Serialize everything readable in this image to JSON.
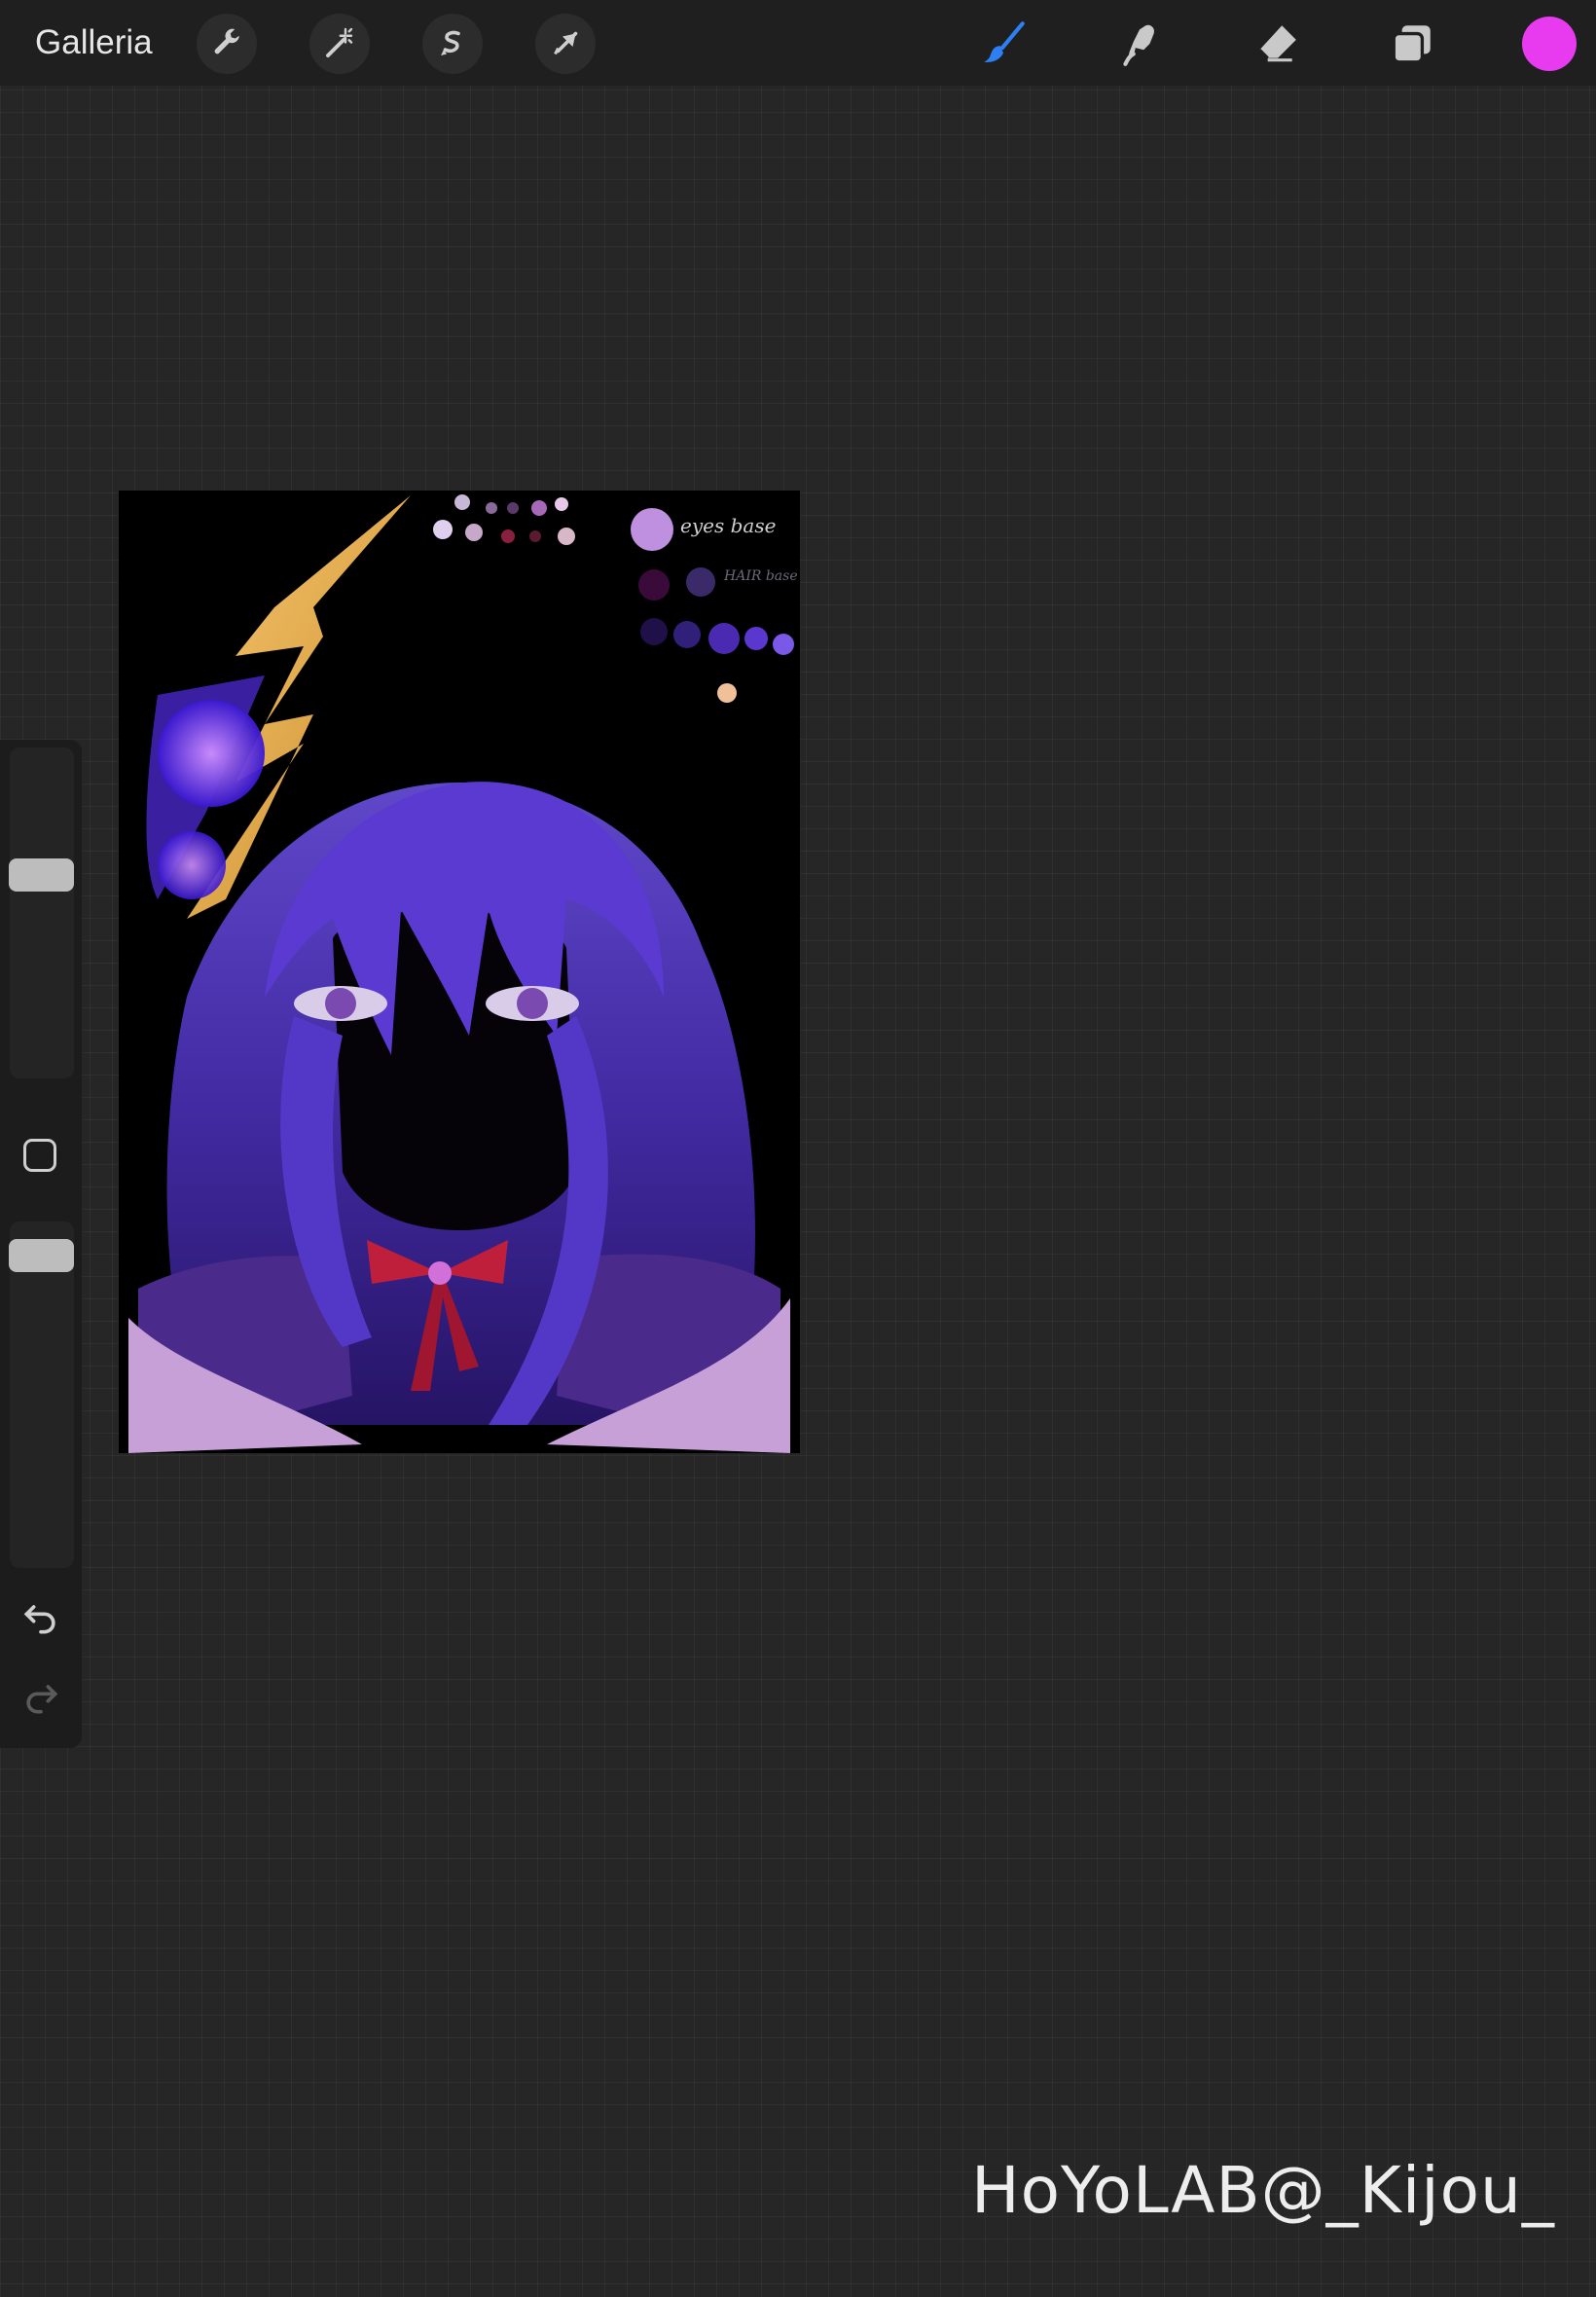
{
  "topbar": {
    "gallery_label": "Galleria",
    "actions": [
      {
        "name": "wrench-icon",
        "meaning": "actions"
      },
      {
        "name": "magic-wand-icon",
        "meaning": "adjustments"
      },
      {
        "name": "selection-icon",
        "meaning": "selection"
      },
      {
        "name": "transform-arrow-icon",
        "meaning": "transform"
      }
    ],
    "tools": [
      {
        "name": "brush-icon",
        "active": true
      },
      {
        "name": "smudge-icon",
        "active": false
      },
      {
        "name": "eraser-icon",
        "active": false
      },
      {
        "name": "layers-icon",
        "active": false
      }
    ],
    "current_color": "#e83bf0"
  },
  "sidebar": {
    "brush_size_level": 0.4,
    "opacity_level": 0.15,
    "icons": [
      "modify-square-icon",
      "undo-icon",
      "redo-icon"
    ]
  },
  "artwork": {
    "palette_labels": [
      "eyes base",
      "HAIR base"
    ]
  },
  "colors": {
    "active_tool": "#2d7ff2",
    "icon": "#c9c9c9",
    "hair": "#4a2fb5",
    "ornament": "#f0b24c",
    "ribbon": "#c01f3c"
  },
  "watermark": "HoYoLAB@_Kijou_"
}
